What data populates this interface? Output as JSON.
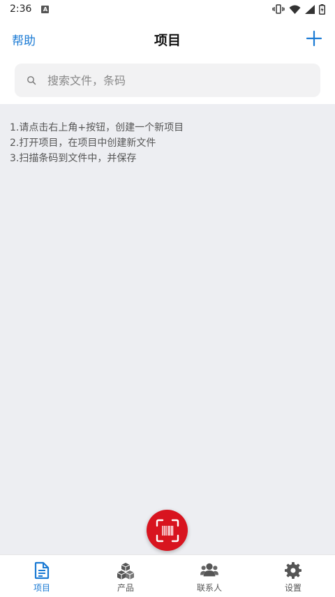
{
  "status_bar": {
    "time": "2:36",
    "notification_icon": "A"
  },
  "header": {
    "help_label": "帮助",
    "title": "项目",
    "add_icon": "plus-icon"
  },
  "search": {
    "placeholder": "搜索文件，条码"
  },
  "instructions": [
    "1.请点击右上角+按钮，创建一个新项目",
    "2.打开项目，在项目中创建新文件",
    "3.扫描条码到文件中，并保存"
  ],
  "fab": {
    "icon": "barcode-scan-icon"
  },
  "nav": [
    {
      "label": "项目",
      "icon": "document-icon",
      "active": true
    },
    {
      "label": "产品",
      "icon": "boxes-icon",
      "active": false
    },
    {
      "label": "联系人",
      "icon": "people-icon",
      "active": false
    },
    {
      "label": "设置",
      "icon": "gear-icon",
      "active": false
    }
  ],
  "colors": {
    "accent": "#1a7ad4",
    "fab": "#d8141f",
    "content_bg": "#edeef2"
  }
}
